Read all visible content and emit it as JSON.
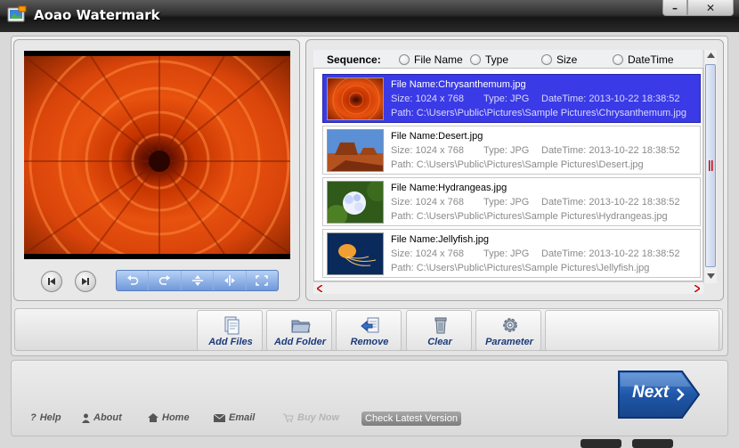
{
  "window": {
    "title": "Aoao Watermark",
    "minimize_label": "–",
    "close_label": "✕"
  },
  "sequence": {
    "label": "Sequence:",
    "options": [
      "File Name",
      "Type",
      "Size",
      "DateTime"
    ]
  },
  "files": [
    {
      "name_line": "File Name:Chrysanthemum.jpg",
      "size": "Size: 1024 x 768",
      "type": "Type: JPG",
      "datetime": "DateTime: 2013-10-22 18:38:52",
      "path": "Path: C:\\Users\\Public\\Pictures\\Sample Pictures\\Chrysanthemum.jpg",
      "selected": true
    },
    {
      "name_line": "File Name:Desert.jpg",
      "size": "Size: 1024 x 768",
      "type": "Type: JPG",
      "datetime": "DateTime: 2013-10-22 18:38:52",
      "path": "Path: C:\\Users\\Public\\Pictures\\Sample Pictures\\Desert.jpg",
      "selected": false
    },
    {
      "name_line": "File Name:Hydrangeas.jpg",
      "size": "Size: 1024 x 768",
      "type": "Type: JPG",
      "datetime": "DateTime: 2013-10-22 18:38:52",
      "path": "Path: C:\\Users\\Public\\Pictures\\Sample Pictures\\Hydrangeas.jpg",
      "selected": false
    },
    {
      "name_line": "File Name:Jellyfish.jpg",
      "size": "Size: 1024 x 768",
      "type": "Type: JPG",
      "datetime": "DateTime: 2013-10-22 18:38:52",
      "path": "Path: C:\\Users\\Public\\Pictures\\Sample Pictures\\Jellyfish.jpg",
      "selected": false
    }
  ],
  "actions": {
    "add_files": "Add Files",
    "add_folder": "Add Folder",
    "remove": "Remove",
    "clear": "Clear",
    "parameter": "Parameter"
  },
  "footer": {
    "help": "Help",
    "about": "About",
    "home": "Home",
    "email": "Email",
    "buy_now": "Buy Now",
    "check_version": "Check Latest Version",
    "next": "Next"
  },
  "colors": {
    "selection": "#3a3ae6",
    "next_button": "#1f57a8",
    "action_label": "#1a3a7a"
  }
}
